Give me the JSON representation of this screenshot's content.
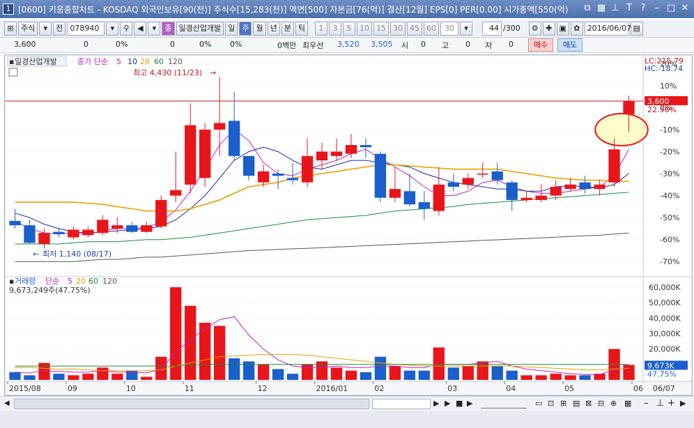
{
  "window": {
    "index": "1",
    "title": "[0600] 키움종합차트 - KOSDAQ 외국인보유[90(천)] 주식수[15,283(천)] 액면[500] 자본금[76(억)] 결산[12월] EPS[0] PER[0.00] 시가총액[550(억)"
  },
  "toolbar": {
    "market": "주식",
    "prev_label": "전",
    "code": "078940",
    "company_button": "일경산업개발",
    "company_prefix": "종",
    "periods": [
      "일",
      "주",
      "월",
      "년",
      "분",
      "틱"
    ],
    "selected_period": "주",
    "intervals": [
      "1",
      "3",
      "5",
      "10",
      "15",
      "30",
      "45",
      "60"
    ],
    "interval_value": "30",
    "count": "44",
    "count_max": "/300",
    "date": "2016/06/07"
  },
  "quote": {
    "price": "3,600",
    "change": "0",
    "change_pct": "0%",
    "volume": "0",
    "volume_pct": "0%",
    "pct3": "0%",
    "amount": "0백만",
    "best_label": "최우선",
    "ask": "3,520",
    "bid": "3,505",
    "open_label": "시",
    "open": "0",
    "high_label": "고",
    "high": "0",
    "low_label": "저",
    "low": "0",
    "buy": "매수",
    "sell": "매도"
  },
  "price_panel": {
    "legend_name": "일경산업개발",
    "legend_ma": "종가 단순",
    "ma_periods": [
      "5",
      "10",
      "20",
      "60",
      "120"
    ],
    "ma_colors": [
      "#c020c0",
      "#1a2a9c",
      "#e8a000",
      "#1a8a3a",
      "#555555"
    ],
    "annotation_high": "최고 4,430 (11/23)",
    "annotation_low": "최저 1,140 (08/17)",
    "lc": "LC:215.79",
    "hc": "HC:-18.74",
    "current_price_label": "3,600",
    "current_pct_label": "22.56%",
    "y_ticks": [
      "20%",
      "10%",
      "0%",
      "-10%",
      "-20%",
      "-30%",
      "-40%",
      "-50%",
      "-60%",
      "-70%"
    ]
  },
  "volume_panel": {
    "legend_name": "거래량",
    "legend_ma": "단순",
    "ma_periods": [
      "5",
      "20",
      "60",
      "120"
    ],
    "ma_colors": [
      "#c020c0",
      "#e8a000",
      "#1a8a3a",
      "#555555"
    ],
    "value_label": "9,673,249주(47.75%)",
    "current_label": "9,673K",
    "current_pct": "47.75%",
    "y_ticks": [
      "60,000K",
      "50,000K",
      "40,000K",
      "30,000K",
      "20,000K",
      "10,000K"
    ]
  },
  "x_axis": {
    "labels": [
      "2015/08",
      "09",
      "10",
      "11",
      "12",
      "2016/01",
      "02",
      "03",
      "04",
      "05",
      "06"
    ],
    "right_label": "06/07"
  },
  "colors": {
    "up": "#e8161b",
    "down": "#1b5fcc",
    "ring": "#e8161b",
    "ring_fill": "#fff7a0"
  },
  "chart_data": {
    "type": "candlestick",
    "unit": "percent",
    "candles": [
      {
        "o": -51.5,
        "c": -53.5,
        "h": -46,
        "l": -55
      },
      {
        "o": -53.5,
        "c": -61.5,
        "h": -51,
        "l": -62
      },
      {
        "o": -62,
        "c": -57,
        "h": -55,
        "l": -64
      },
      {
        "o": -56.5,
        "c": -57.5,
        "h": -55,
        "l": -59
      },
      {
        "o": -59,
        "c": -55.5,
        "h": -54,
        "l": -60
      },
      {
        "o": -58,
        "c": -55.5,
        "h": -54,
        "l": -59
      },
      {
        "o": -57,
        "c": -51,
        "h": -49,
        "l": -58
      },
      {
        "o": -55,
        "c": -53.5,
        "h": -50,
        "l": -57
      },
      {
        "o": -53.5,
        "c": -56.5,
        "h": -52,
        "l": -57
      },
      {
        "o": -56.5,
        "c": -53.5,
        "h": -52,
        "l": -57
      },
      {
        "o": -54,
        "c": -42,
        "h": -40,
        "l": -55
      },
      {
        "o": -40,
        "c": -37.5,
        "h": -20,
        "l": -43
      },
      {
        "o": -35,
        "c": -8,
        "h": 2,
        "l": -39
      },
      {
        "o": -32,
        "c": -10,
        "h": -7,
        "l": -36
      },
      {
        "o": -10,
        "c": -7,
        "h": 14,
        "l": -22
      },
      {
        "o": -6,
        "c": -22,
        "h": 7,
        "l": -24
      },
      {
        "o": -22,
        "c": -31,
        "h": -24,
        "l": -33
      },
      {
        "o": -34,
        "c": -29,
        "h": -26,
        "l": -36
      },
      {
        "o": -30,
        "c": -31,
        "h": -28,
        "l": -37
      },
      {
        "o": -32,
        "c": -33,
        "h": -25,
        "l": -35
      },
      {
        "o": -34,
        "c": -22,
        "h": -14,
        "l": -36
      },
      {
        "o": -24,
        "c": -20,
        "h": -16,
        "l": -28
      },
      {
        "o": -22,
        "c": -20,
        "h": -14,
        "l": -24
      },
      {
        "o": -21,
        "c": -17,
        "h": -12,
        "l": -23
      },
      {
        "o": -17,
        "c": -18,
        "h": -14,
        "l": -23
      },
      {
        "o": -21,
        "c": -41,
        "h": -20,
        "l": -43
      },
      {
        "o": -41,
        "c": -37,
        "h": -27,
        "l": -43
      },
      {
        "o": -38,
        "c": -44,
        "h": -30,
        "l": -45
      },
      {
        "o": -43,
        "c": -46,
        "h": -38,
        "l": -51
      },
      {
        "o": -47,
        "c": -35,
        "h": -27,
        "l": -49
      },
      {
        "o": -34,
        "c": -36,
        "h": -30,
        "l": -38
      },
      {
        "o": -35,
        "c": -32,
        "h": -30,
        "l": -37
      },
      {
        "o": -30,
        "c": -30,
        "h": -25,
        "l": -32
      },
      {
        "o": -29,
        "c": -33,
        "h": -25,
        "l": -35
      },
      {
        "o": -34,
        "c": -42,
        "h": -33,
        "l": -47
      },
      {
        "o": -42,
        "c": -41,
        "h": -38,
        "l": -43
      },
      {
        "o": -42,
        "c": -40,
        "h": -35,
        "l": -43
      },
      {
        "o": -40,
        "c": -36,
        "h": -33,
        "l": -42
      },
      {
        "o": -37,
        "c": -35,
        "h": -32,
        "l": -38
      },
      {
        "o": -34,
        "c": -37,
        "h": -31,
        "l": -39
      },
      {
        "o": -37,
        "c": -35,
        "h": -33,
        "l": -40
      },
      {
        "o": -34,
        "c": -19,
        "h": -14,
        "l": -36
      },
      {
        "o": -3,
        "c": 3,
        "h": 5.5,
        "l": -11
      }
    ],
    "volume": [
      5,
      3,
      11,
      4,
      3,
      4,
      8,
      4,
      6,
      2,
      15,
      60,
      48,
      37,
      35,
      14,
      12,
      10,
      7,
      4,
      10,
      12,
      8,
      6,
      5,
      15,
      9,
      6,
      6,
      21,
      8,
      9,
      12,
      9,
      6,
      3,
      3,
      4,
      3,
      3,
      4,
      20,
      9.7
    ],
    "ma_price": {
      "ma5": [
        -51.5,
        -55,
        -57,
        -57.5,
        -57,
        -57.5,
        -56,
        -55,
        -55,
        -54.5,
        -52,
        -46.5,
        -38,
        -28,
        -17,
        -10,
        -15,
        -25,
        -30,
        -31,
        -28,
        -26,
        -24,
        -21,
        -19,
        -23,
        -27,
        -31,
        -36,
        -40,
        -40,
        -38,
        -34,
        -33,
        -36,
        -38,
        -39,
        -39,
        -38,
        -37,
        -36,
        -31,
        -19
      ],
      "ma10": [
        -48,
        -50,
        -53,
        -55,
        -56.5,
        -57,
        -56.5,
        -56,
        -55.5,
        -55,
        -54,
        -51,
        -46,
        -40,
        -32,
        -24,
        -20,
        -18,
        -20,
        -24,
        -27,
        -28,
        -26,
        -24,
        -24,
        -25,
        -26,
        -27,
        -30,
        -32,
        -34,
        -35,
        -36,
        -37,
        -37,
        -38,
        -38,
        -36,
        -35.5,
        -36,
        -36.5,
        -35,
        -30
      ],
      "ma20": [
        -43,
        -43,
        -43,
        -43,
        -43,
        -43.5,
        -44,
        -45,
        -46,
        -47,
        -47,
        -47,
        -46,
        -44,
        -42,
        -39,
        -36,
        -35,
        -34,
        -32,
        -31,
        -30,
        -29,
        -28,
        -27,
        -26,
        -26,
        -26.5,
        -27,
        -27.5,
        -28,
        -28,
        -28,
        -28,
        -29,
        -30,
        -31,
        -32,
        -32.5,
        -33,
        -33,
        -33.5,
        -33.5
      ],
      "ma60": [
        -62,
        -62,
        -62,
        -62,
        -61.5,
        -61,
        -61,
        -61,
        -60.5,
        -60,
        -60,
        -59.5,
        -59,
        -58,
        -57,
        -56,
        -55,
        -54,
        -53,
        -52,
        -51,
        -50.5,
        -50,
        -49.5,
        -49,
        -48,
        -47,
        -46.5,
        -46,
        -45.5,
        -45,
        -44,
        -43.5,
        -43,
        -42.5,
        -42,
        -41.5,
        -41,
        -40.5,
        -40,
        -39.5,
        -39,
        -38.5
      ],
      "ma120": [
        -70,
        -70,
        -70,
        -70,
        -70,
        -69.5,
        -69,
        -69,
        -68.5,
        -68,
        -68,
        -67.5,
        -67,
        -66.5,
        -66,
        -65.5,
        -65,
        -64.8,
        -64.5,
        -64.2,
        -64,
        -63.7,
        -63.4,
        -63.1,
        -62.8,
        -62.5,
        -62.2,
        -61.9,
        -61.6,
        -61.3,
        -61,
        -60.7,
        -60.4,
        -60.1,
        -59.8,
        -59.5,
        -59.2,
        -58.9,
        -58.6,
        -58.3,
        -58,
        -57.5,
        -57
      ]
    },
    "ma_volume": {
      "ma5": [
        5,
        4.5,
        6,
        5.5,
        5,
        5,
        6,
        5,
        5,
        4.5,
        7,
        18,
        26,
        33,
        39,
        41,
        29,
        20,
        13,
        9,
        8,
        8,
        9,
        8,
        8,
        9,
        9,
        8,
        8,
        10,
        10,
        10,
        11,
        12,
        9,
        7,
        6,
        5,
        4,
        3.5,
        3.5,
        6.5,
        8
      ],
      "ma20": [
        8,
        8,
        7.5,
        7,
        7,
        6.5,
        6,
        6,
        6,
        6,
        6.5,
        9,
        11,
        13,
        15,
        15.5,
        16,
        16.5,
        16.5,
        16.5,
        16,
        15,
        14,
        13,
        12,
        11,
        10,
        9.5,
        9,
        9,
        9,
        9,
        9,
        9,
        9,
        8.5,
        8,
        7.5,
        7,
        6.5,
        6.5,
        7,
        7.5
      ],
      "ma60": [
        9,
        9,
        9,
        9,
        9,
        9,
        9,
        9,
        9,
        9,
        9,
        9,
        9.5,
        10,
        10,
        10,
        10,
        10,
        10,
        10,
        10,
        10,
        10,
        10,
        10,
        10,
        10,
        10,
        10,
        10,
        10,
        10,
        10,
        10,
        10,
        10,
        10,
        10,
        10,
        10,
        10,
        10,
        10
      ]
    },
    "x_tick_index": [
      0,
      4,
      8,
      12,
      17,
      21,
      25,
      30,
      34,
      38,
      43
    ],
    "ylim_price": [
      -75,
      22
    ],
    "ylim_volume": [
      0,
      65
    ]
  }
}
